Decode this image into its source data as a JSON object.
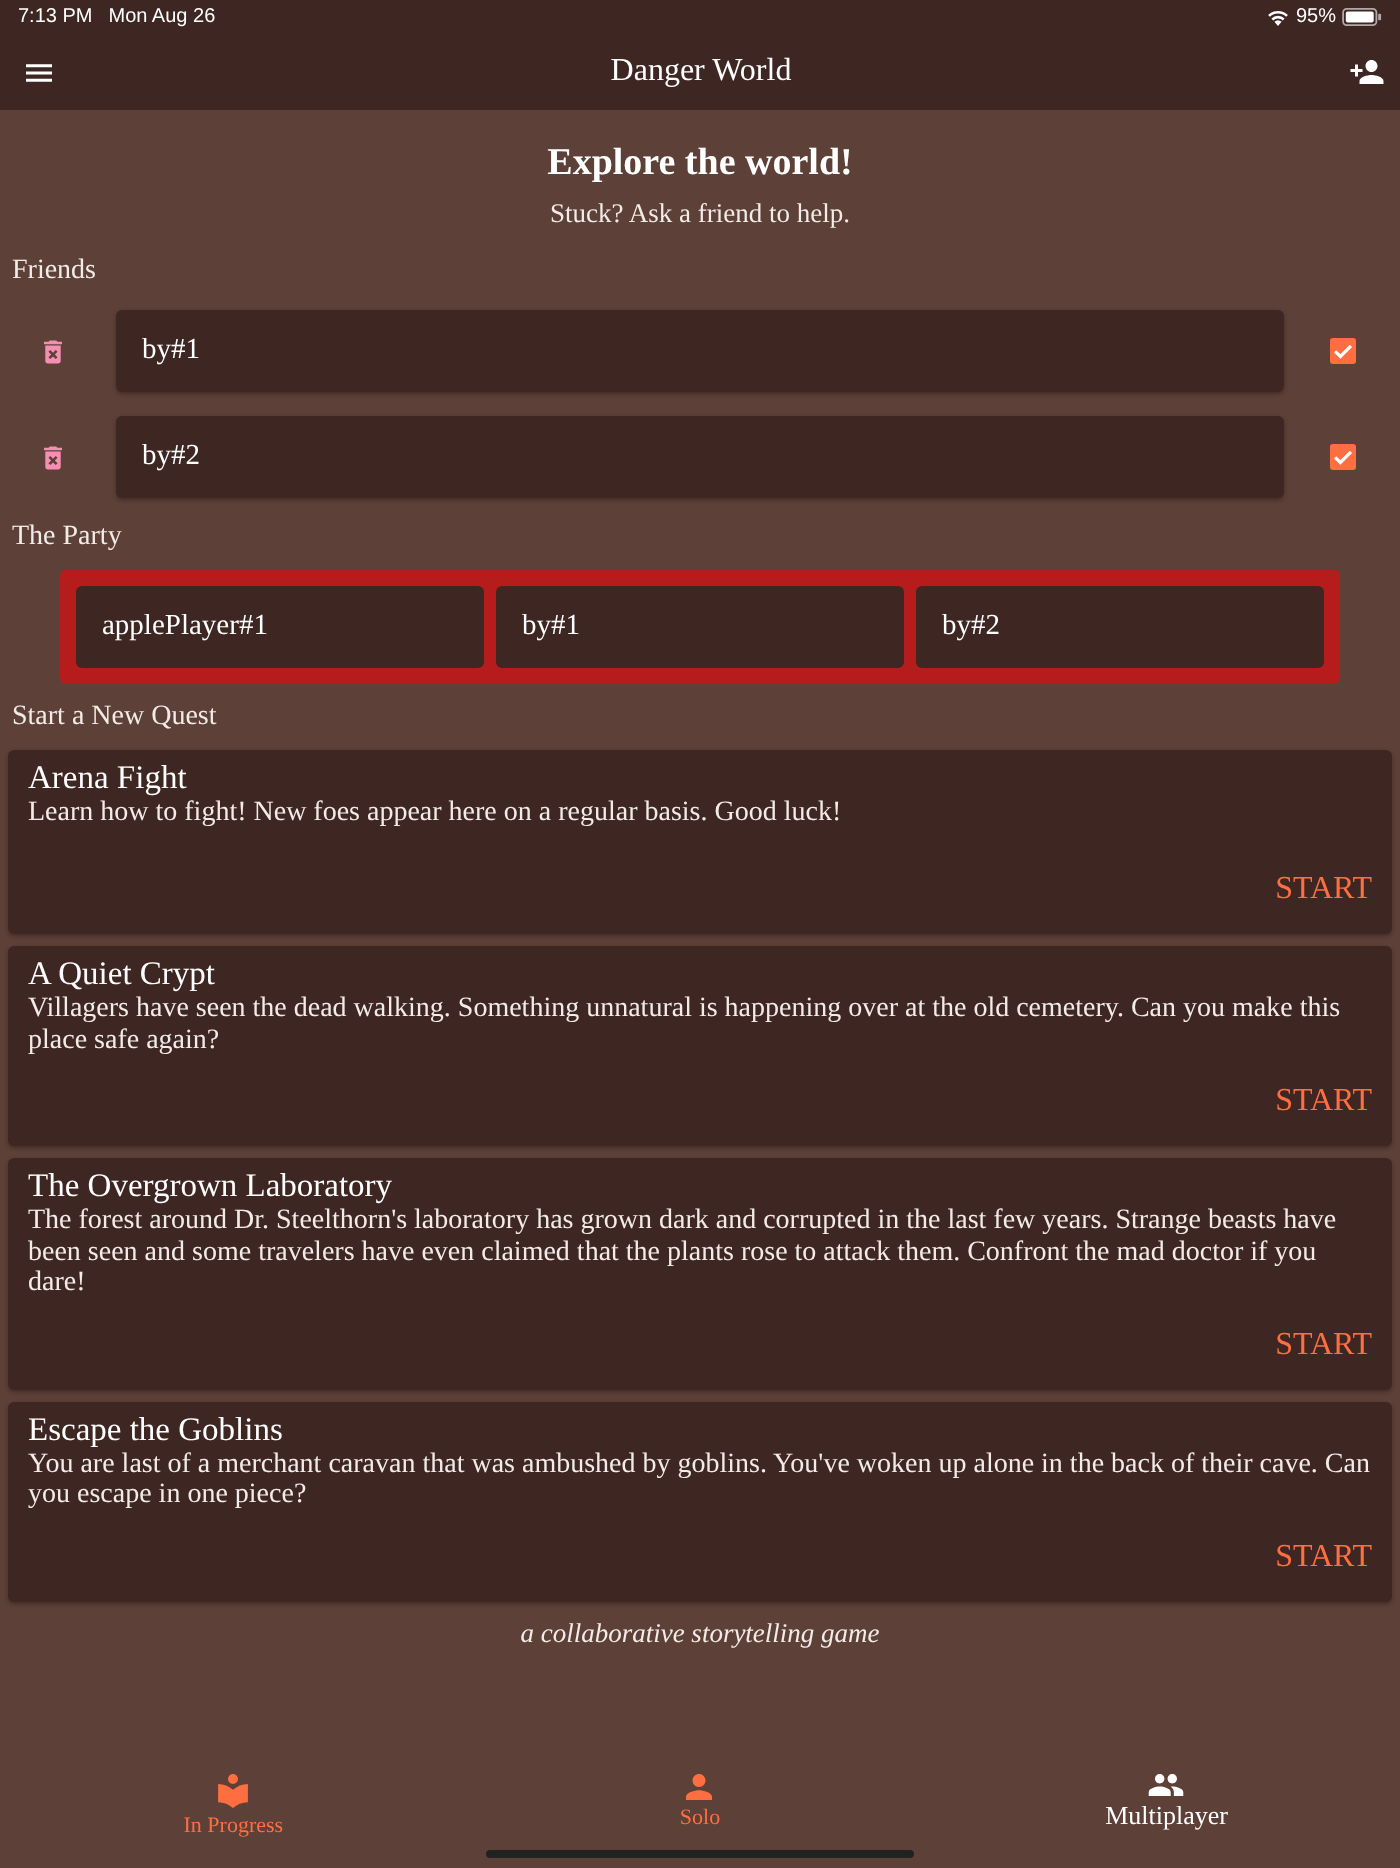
{
  "status_bar": {
    "time": "7:13 PM",
    "date": "Mon Aug 26",
    "battery": "95%"
  },
  "app_bar": {
    "title": "Danger World"
  },
  "intro": {
    "title": "Explore the world!",
    "subtitle": "Stuck? Ask a friend to help."
  },
  "friends": {
    "heading": "Friends",
    "items": [
      {
        "name": "by#1",
        "checked": true
      },
      {
        "name": "by#2",
        "checked": true
      }
    ]
  },
  "party": {
    "heading": "The Party",
    "members": [
      "applePlayer#1",
      "by#1",
      "by#2"
    ]
  },
  "quests": {
    "heading": "Start a New Quest",
    "items": [
      {
        "title": "Arena Fight",
        "description": "Learn how to fight! New foes appear here on a regular basis. Good luck!",
        "action": "START"
      },
      {
        "title": "A Quiet Crypt",
        "description": "Villagers have seen the dead walking. Something unnatural is happening over at the old cemetery. Can you make this place safe again?",
        "action": "START"
      },
      {
        "title": "The Overgrown Laboratory",
        "description": "The forest around Dr. Steelthorn's laboratory has grown dark and corrupted in the last few years. Strange beasts have been seen and some travelers have even claimed that the plants rose to attack them. Confront the mad doctor if you dare!",
        "action": "START"
      },
      {
        "title": "Escape the Goblins",
        "description": "You are last of a merchant caravan that was ambushed by goblins. You've woken up alone in the back of their cave. Can you escape in one piece?",
        "action": "START"
      }
    ]
  },
  "footer": {
    "tagline": "a collaborative storytelling game"
  },
  "tab_bar": [
    {
      "label": "In Progress",
      "selected": false
    },
    {
      "label": "Solo",
      "selected": false
    },
    {
      "label": "Multiplayer",
      "selected": true
    }
  ]
}
